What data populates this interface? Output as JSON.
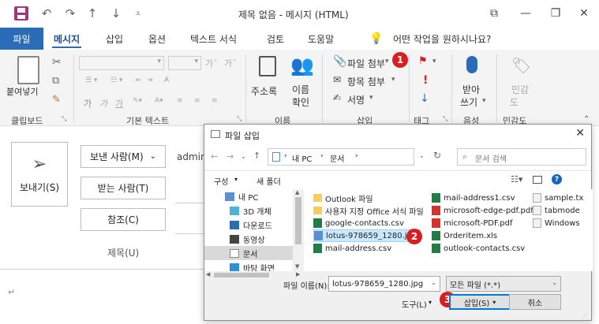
{
  "titlebar": {
    "title": "제목 없음  -  메시지 (HTML)",
    "undo": "↶",
    "redo": "↷",
    "up": "↑",
    "down": "↓",
    "customize": "⩡",
    "ribbon_display": "⧉",
    "minimize": "—",
    "restore": "❐",
    "close": "✕"
  },
  "tabs": {
    "file": "파일",
    "items": [
      "메시지",
      "삽입",
      "옵션",
      "텍스트 서식",
      "검토",
      "도움말"
    ],
    "active": "메시지",
    "tell_me": "어떤 작업을 원하시나요?"
  },
  "ribbon": {
    "clipboard": {
      "paste": "붙여넣기",
      "label": "클립보드"
    },
    "basic_text": {
      "label": "기본 텍스트",
      "bold": "가",
      "italic": "가",
      "underline": "가",
      "grow": "가ˆ",
      "shrink": "가ˇ"
    },
    "names": {
      "address_book": "주소록",
      "check_names_1": "이름",
      "check_names_2": "확인",
      "label": "이름"
    },
    "include": {
      "attach_file": "파일 첨부",
      "item": "항목 첨부",
      "signature": "서명",
      "label": "삽입"
    },
    "tags": {
      "label": "태그"
    },
    "voice": {
      "dictate_1": "받아",
      "dictate_2": "쓰기",
      "label": "음성"
    },
    "sensitivity": {
      "s1": "민감",
      "s2": "도",
      "label": "민감도"
    }
  },
  "compose": {
    "send": "보내기(S)",
    "from": "보낸 사람(M)",
    "from_value": "admin",
    "to": "받는 사람(T)",
    "cc": "참조(C)",
    "subject": "제목(U)"
  },
  "dialog": {
    "title": "파일 삽입",
    "breadcrumb": [
      "내 PC",
      "문서"
    ],
    "search_placeholder": "문서 검색",
    "organize": "구성",
    "new_folder": "새 폴더",
    "nav": [
      "내 PC",
      "3D 개체",
      "다운로드",
      "동영상",
      "문서",
      "바탕 화면"
    ],
    "nav_selected": "문서",
    "files_col1": [
      "Outlook 파일",
      "사용자 지정 Office 서식 파일",
      "google-contacts.csv",
      "lotus-978659_1280.jpg",
      "mail-address.csv"
    ],
    "files_col2": [
      "mail-address1.csv",
      "microsoft-edge-pdf.pdf",
      "microsoft-PDF.pdf",
      "Orderitem.xls",
      "outlook-contacts.csv"
    ],
    "files_col3": [
      "sample.tx",
      "tabmode",
      "Windows"
    ],
    "filename_label": "파일 이름(N):",
    "filename_value": "lotus-978659_1280.jpg",
    "filetype_value": "모든 파일 (*.*)",
    "tools": "도구(L)",
    "insert": "삽입(S)",
    "cancel": "취소"
  },
  "steps": [
    "1",
    "2",
    "3"
  ],
  "colors": {
    "accent": "#2b6cb8",
    "badge": "#d81e1e",
    "selection": "#cce8ff"
  }
}
